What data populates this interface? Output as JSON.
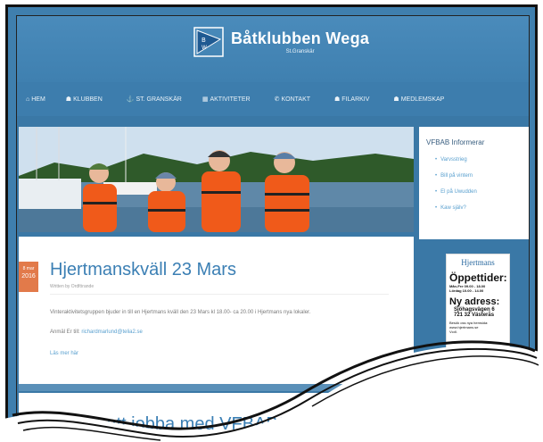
{
  "header": {
    "brand_name": "Båtklubben Wega",
    "brand_sub": "St.Granskär"
  },
  "nav": {
    "items": [
      {
        "icon": "home-icon",
        "glyph": "⌂",
        "label": "HEM"
      },
      {
        "icon": "users-icon",
        "glyph": "☗",
        "label": "KLUBBEN"
      },
      {
        "icon": "anchor-icon",
        "glyph": "⚓",
        "label": "ST. GRANSKÄR"
      },
      {
        "icon": "calendar-icon",
        "glyph": "▦",
        "label": "AKTIVITETER"
      },
      {
        "icon": "phone-icon",
        "glyph": "✆",
        "label": "KONTAKT"
      },
      {
        "icon": "user-icon",
        "glyph": "☗",
        "label": "FILARKIV"
      },
      {
        "icon": "members-icon",
        "glyph": "☗",
        "label": "MEDLEMSKAP"
      }
    ]
  },
  "sidebar": {
    "title": "VFBAB Informerar",
    "items": [
      "Varvsstrieg",
      "Bill på vintern",
      "El på Uwudden",
      "Kaw själv?"
    ]
  },
  "ad": {
    "logo": "Hjertmans",
    "hours_title": "Öppettider:",
    "hours_line1": "Mån-Fre   09.00 - 18.00",
    "hours_line2": "Lördag     10.00 - 14.00",
    "addr_title": "Ny adress:",
    "addr_line1": "Sjöhagsvägen 6",
    "addr_line2": "721 32   Västerås",
    "small1": "Besök oss nya hemsida:",
    "small2": "www.hjertmans.se",
    "small3": "Vcdl."
  },
  "article": {
    "date_day": "8 mar",
    "date_year": "2016",
    "title": "Hjertmanskväll 23 Mars",
    "author": "Written by Ordförande",
    "body1": "Vinteraktivitetsgruppen bjuder in till en Hjertmans kväll den 23 Mars kl 18.00- ca 20.00 i Hjertmans nya lokaler.",
    "body2_prefix": "Anmäl Er till: ",
    "body2_link": "richardmarlund@telia2.se",
    "more": "Läs mer här"
  },
  "article2": {
    "title": "Sugen att jobba med VFBAB?"
  },
  "colors": {
    "header_blue": "#4a8bbb",
    "accent_orange": "#e27a4a",
    "link_blue": "#5aa0cf",
    "title_blue": "#3b7fb4"
  }
}
